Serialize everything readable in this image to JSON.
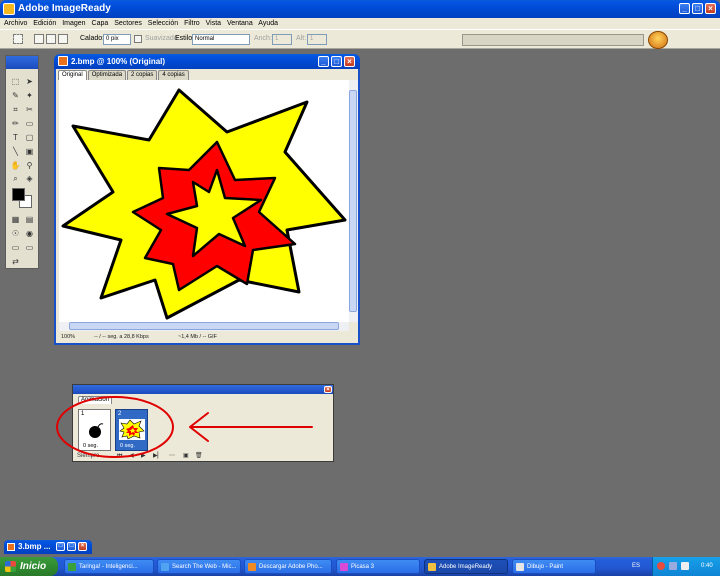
{
  "app": {
    "title": "Adobe ImageReady"
  },
  "menu": [
    "Archivo",
    "Edición",
    "Imagen",
    "Capa",
    "Sectores",
    "Selección",
    "Filtro",
    "Vista",
    "Ventana",
    "Ayuda"
  ],
  "options": {
    "calado_label": "Calado:",
    "calado_value": "0 pix",
    "suavizado_label": "Suavizado",
    "estilo_label": "Estilo:",
    "estilo_value": "Normal",
    "ancho_label": "Anch:",
    "ancho_value": "1",
    "alto_label": "Alt:",
    "alto_value": "1"
  },
  "document": {
    "title": "2.bmp @ 100% (Original)",
    "tabs": [
      "Original",
      "Optimizada",
      "2 copias",
      "4 copias"
    ],
    "active_tab": 0,
    "status": {
      "zoom": "100%",
      "transfer": "-- / -- seg. a 28,8 Kbps",
      "size": "~1,4 Mb / -- GIF"
    },
    "colors": {
      "outer_star": "#ffff00",
      "middle_star": "#ff0000",
      "inner_star": "#ffff00",
      "outline": "#000000"
    }
  },
  "animation": {
    "tab": "Animación",
    "frames": [
      {
        "number": "1",
        "delay": "0 seg.",
        "content": "bomb"
      },
      {
        "number": "2",
        "delay": "0 seg.",
        "content": "explosion"
      }
    ],
    "selected_frame": 1,
    "loop": "Siempre"
  },
  "annotation": {
    "circle_color": "#e00000",
    "arrow_color": "#e00000"
  },
  "minimized_doc": {
    "title": "3.bmp ..."
  },
  "taskbar": {
    "start": "Inicio",
    "tasks": [
      {
        "label": "Taringa! - Inteligenci..."
      },
      {
        "label": "Search The Web - Mic..."
      },
      {
        "label": "Descargar Adobe Pho..."
      },
      {
        "label": "Picasa 3"
      },
      {
        "label": "Adobe ImageReady"
      },
      {
        "label": "Dibujo - Paint"
      }
    ],
    "active_task": 4,
    "language": "ES",
    "clock": "0:40"
  }
}
